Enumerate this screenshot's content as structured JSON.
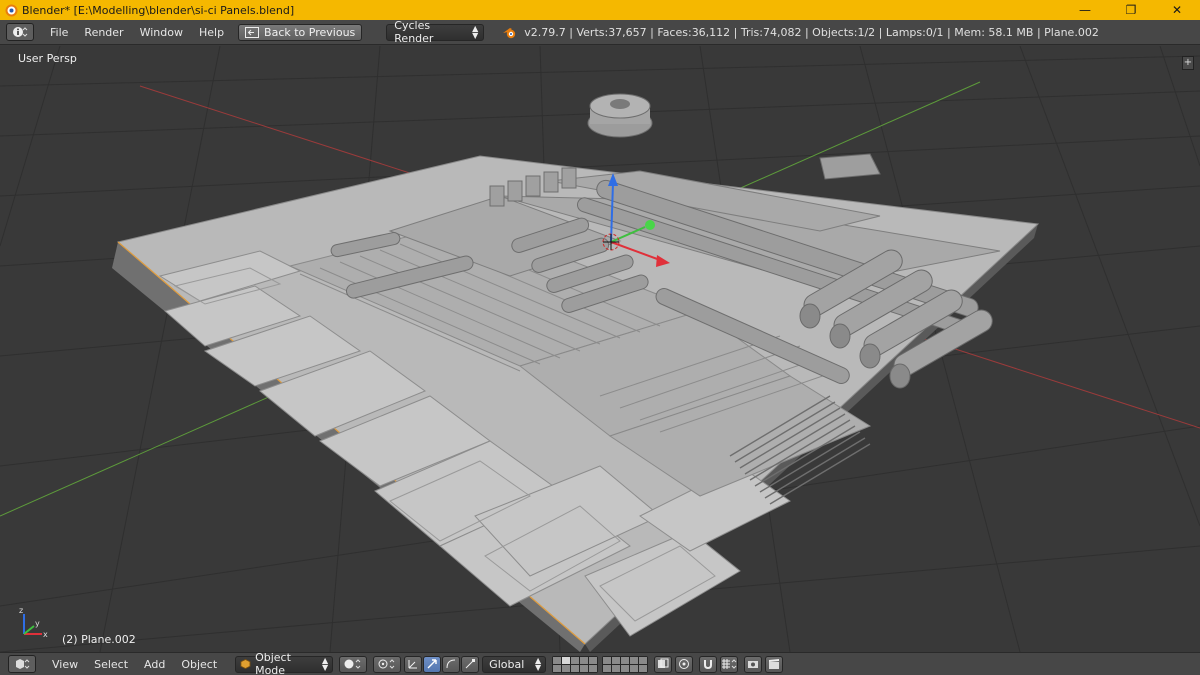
{
  "window": {
    "title": "Blender* [E:\\Modelling\\blender\\si-ci  Panels.blend]",
    "minimize": "—",
    "maximize": "❐",
    "close": "✕"
  },
  "infobar": {
    "menus": [
      "File",
      "Render",
      "Window",
      "Help"
    ],
    "back_button": "Back to Previous",
    "render_engine": "Cycles Render",
    "stats": "v2.79.7 | Verts:37,657 | Faces:36,112 | Tris:74,082 | Objects:1/2 | Lamps:0/1 | Mem: 58.1 MB | Plane.002"
  },
  "viewport": {
    "view_label": "User Persp",
    "object_label": "(2) Plane.002",
    "plus": "+"
  },
  "bottombar": {
    "menus": [
      "View",
      "Select",
      "Add",
      "Object"
    ],
    "mode": "Object Mode",
    "orientation": "Global"
  },
  "colors": {
    "title_bar": "#f5b800",
    "header": "#474747",
    "viewport_bg": "#393939",
    "x_axis": "#9b3b3b",
    "y_axis": "#5d9b3b",
    "mesh": "#b9b9b9"
  }
}
